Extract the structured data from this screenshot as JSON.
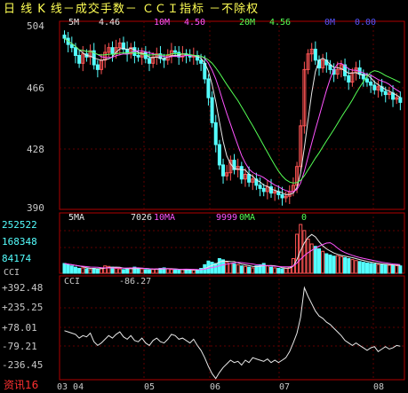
{
  "header": {
    "title": "日  线  K  线－成交手数－ ＣＣＩ指标  －不除权"
  },
  "price_panel": {
    "ma_legend": [
      {
        "label": "5M",
        "value": "4.46",
        "color": "#e8e8e8"
      },
      {
        "label": "10M",
        "value": "4.50",
        "color": "#ff54ff"
      },
      {
        "label": "20M",
        "value": "4.56",
        "color": "#54ff54"
      },
      {
        "label": "0M",
        "value": "0.00",
        "color": "#5454ff"
      }
    ],
    "y_labels": [
      "504",
      "466",
      "428",
      "390"
    ]
  },
  "volume_panel": {
    "legend": [
      {
        "label": "5MA",
        "value": "7026",
        "color": "#e8e8e8"
      },
      {
        "label": "10MA",
        "value": "9999",
        "color": "#ff54ff"
      },
      {
        "label": "0MA",
        "value": "0",
        "color": "#54ff54"
      }
    ],
    "y_labels": [
      "252522",
      "168348",
      "84174"
    ]
  },
  "cci_panel": {
    "name": "CCI",
    "legend_label": "CCI",
    "legend_value": "-86.27",
    "y_labels": [
      "+392.48",
      "+235.25",
      "+78.01",
      "-79.21",
      "-236.45"
    ]
  },
  "x_axis": {
    "labels": [
      "03 04",
      "05",
      "06",
      "07",
      "08"
    ]
  },
  "brand": "资讯16",
  "colors": {
    "up": "#ff5454",
    "down": "#54ffff",
    "frame": "#b00000",
    "grid": "#600000"
  },
  "chart_data": {
    "type": "candlestick",
    "y_ticks_price": [
      "504",
      "466",
      "428",
      "390"
    ],
    "price_close": [
      496,
      492,
      490,
      485,
      480,
      486,
      484,
      488,
      479,
      476,
      482,
      487,
      490,
      486,
      490,
      493,
      489,
      486,
      490,
      485,
      484,
      487,
      483,
      480,
      484,
      486,
      483,
      482,
      485,
      488,
      487,
      484,
      486,
      485,
      484,
      485,
      482,
      480,
      470,
      458,
      442,
      428,
      415,
      408,
      410,
      418,
      412,
      414,
      406,
      409,
      404,
      406,
      402,
      400,
      398,
      401,
      397,
      398,
      396,
      394,
      395,
      398,
      402,
      414,
      440,
      476,
      486,
      489,
      482,
      477,
      482,
      479,
      476,
      473,
      476,
      479,
      472,
      468,
      474,
      477,
      473,
      470,
      468,
      466,
      463,
      465,
      462,
      460,
      461,
      457,
      458,
      455
    ],
    "volume": [
      40,
      35,
      30,
      25,
      20,
      22,
      18,
      15,
      20,
      18,
      22,
      30,
      28,
      25,
      20,
      18,
      15,
      17,
      22,
      25,
      20,
      18,
      15,
      14,
      16,
      18,
      20,
      22,
      18,
      15,
      14,
      13,
      15,
      16,
      14,
      12,
      13,
      20,
      35,
      50,
      45,
      40,
      60,
      55,
      45,
      40,
      38,
      35,
      30,
      28,
      25,
      22,
      30,
      35,
      40,
      30,
      25,
      22,
      20,
      18,
      20,
      25,
      60,
      160,
      200,
      175,
      140,
      120,
      110,
      100,
      90,
      80,
      75,
      70,
      72,
      68,
      64,
      60,
      56,
      52,
      48,
      45,
      42,
      40,
      38,
      36,
      35,
      34,
      33,
      32,
      31,
      30
    ],
    "cci": [
      40,
      30,
      20,
      10,
      -20,
      0,
      -10,
      20,
      -50,
      -80,
      -60,
      -30,
      0,
      -20,
      10,
      30,
      -10,
      -30,
      0,
      -40,
      -50,
      -20,
      -60,
      -80,
      -40,
      -20,
      -50,
      -60,
      -30,
      10,
      0,
      -30,
      -20,
      -40,
      -60,
      -30,
      -80,
      -120,
      -180,
      -250,
      -310,
      -350,
      -300,
      -260,
      -230,
      -200,
      -220,
      -210,
      -240,
      -200,
      -220,
      -180,
      -190,
      -200,
      -210,
      -190,
      -220,
      -200,
      -220,
      -200,
      -180,
      -130,
      -60,
      20,
      150,
      390,
      320,
      260,
      200,
      160,
      140,
      110,
      90,
      60,
      30,
      0,
      -40,
      -60,
      -80,
      -60,
      -80,
      -100,
      -120,
      -100,
      -90,
      -130,
      -110,
      -90,
      -110,
      -100,
      -80,
      -86
    ]
  }
}
